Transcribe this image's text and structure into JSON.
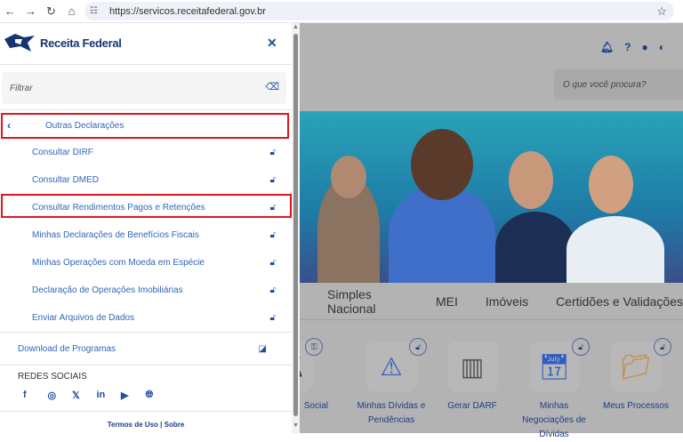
{
  "browser": {
    "url": "https://servicos.receitafederal.gov.br"
  },
  "sidebar": {
    "logo_text": "Receita Federal",
    "filter_placeholder": "Filtrar",
    "section": "Outras Declarações",
    "items": [
      {
        "label": "Consultar DIRF"
      },
      {
        "label": "Consultar DMED"
      },
      {
        "label": "Consultar Rendimentos Pagos e Retenções"
      },
      {
        "label": "Minhas Declarações de Benefícios Fiscais"
      },
      {
        "label": "Minhas Operações com Moeda em Espécie"
      },
      {
        "label": "Declaração de Operações Imobiliárias"
      },
      {
        "label": "Enviar Arquivos de Dados"
      }
    ],
    "download": "Download de Programas",
    "social_title": "REDES SOCIAIS",
    "social_icons": [
      "facebook-icon",
      "instagram-icon",
      "x-icon",
      "linkedin-icon",
      "youtube-icon",
      "globe-icon"
    ],
    "footer_terms": "Termos de Uso",
    "footer_sep": "|",
    "footer_about": "Sobre"
  },
  "main": {
    "search_placeholder": "O que você procura?",
    "menu": [
      "Simples Nacional",
      "MEI",
      "Imóveis",
      "Certidões e Validações"
    ],
    "cards": [
      {
        "label": "Social",
        "badge": "key-icon"
      },
      {
        "label": "Minhas Dívidas e Pendências",
        "badge": "lock-icon"
      },
      {
        "label": "Gerar DARF"
      },
      {
        "label": "Minhas Negociações de Dívidas",
        "badge": "lock-icon"
      },
      {
        "label": "Meus Processos",
        "badge": "lock-icon"
      }
    ]
  },
  "colors": {
    "accent": "#1e4fa3",
    "highlight": "#e0151f",
    "overlay": "#b3b3b3"
  }
}
